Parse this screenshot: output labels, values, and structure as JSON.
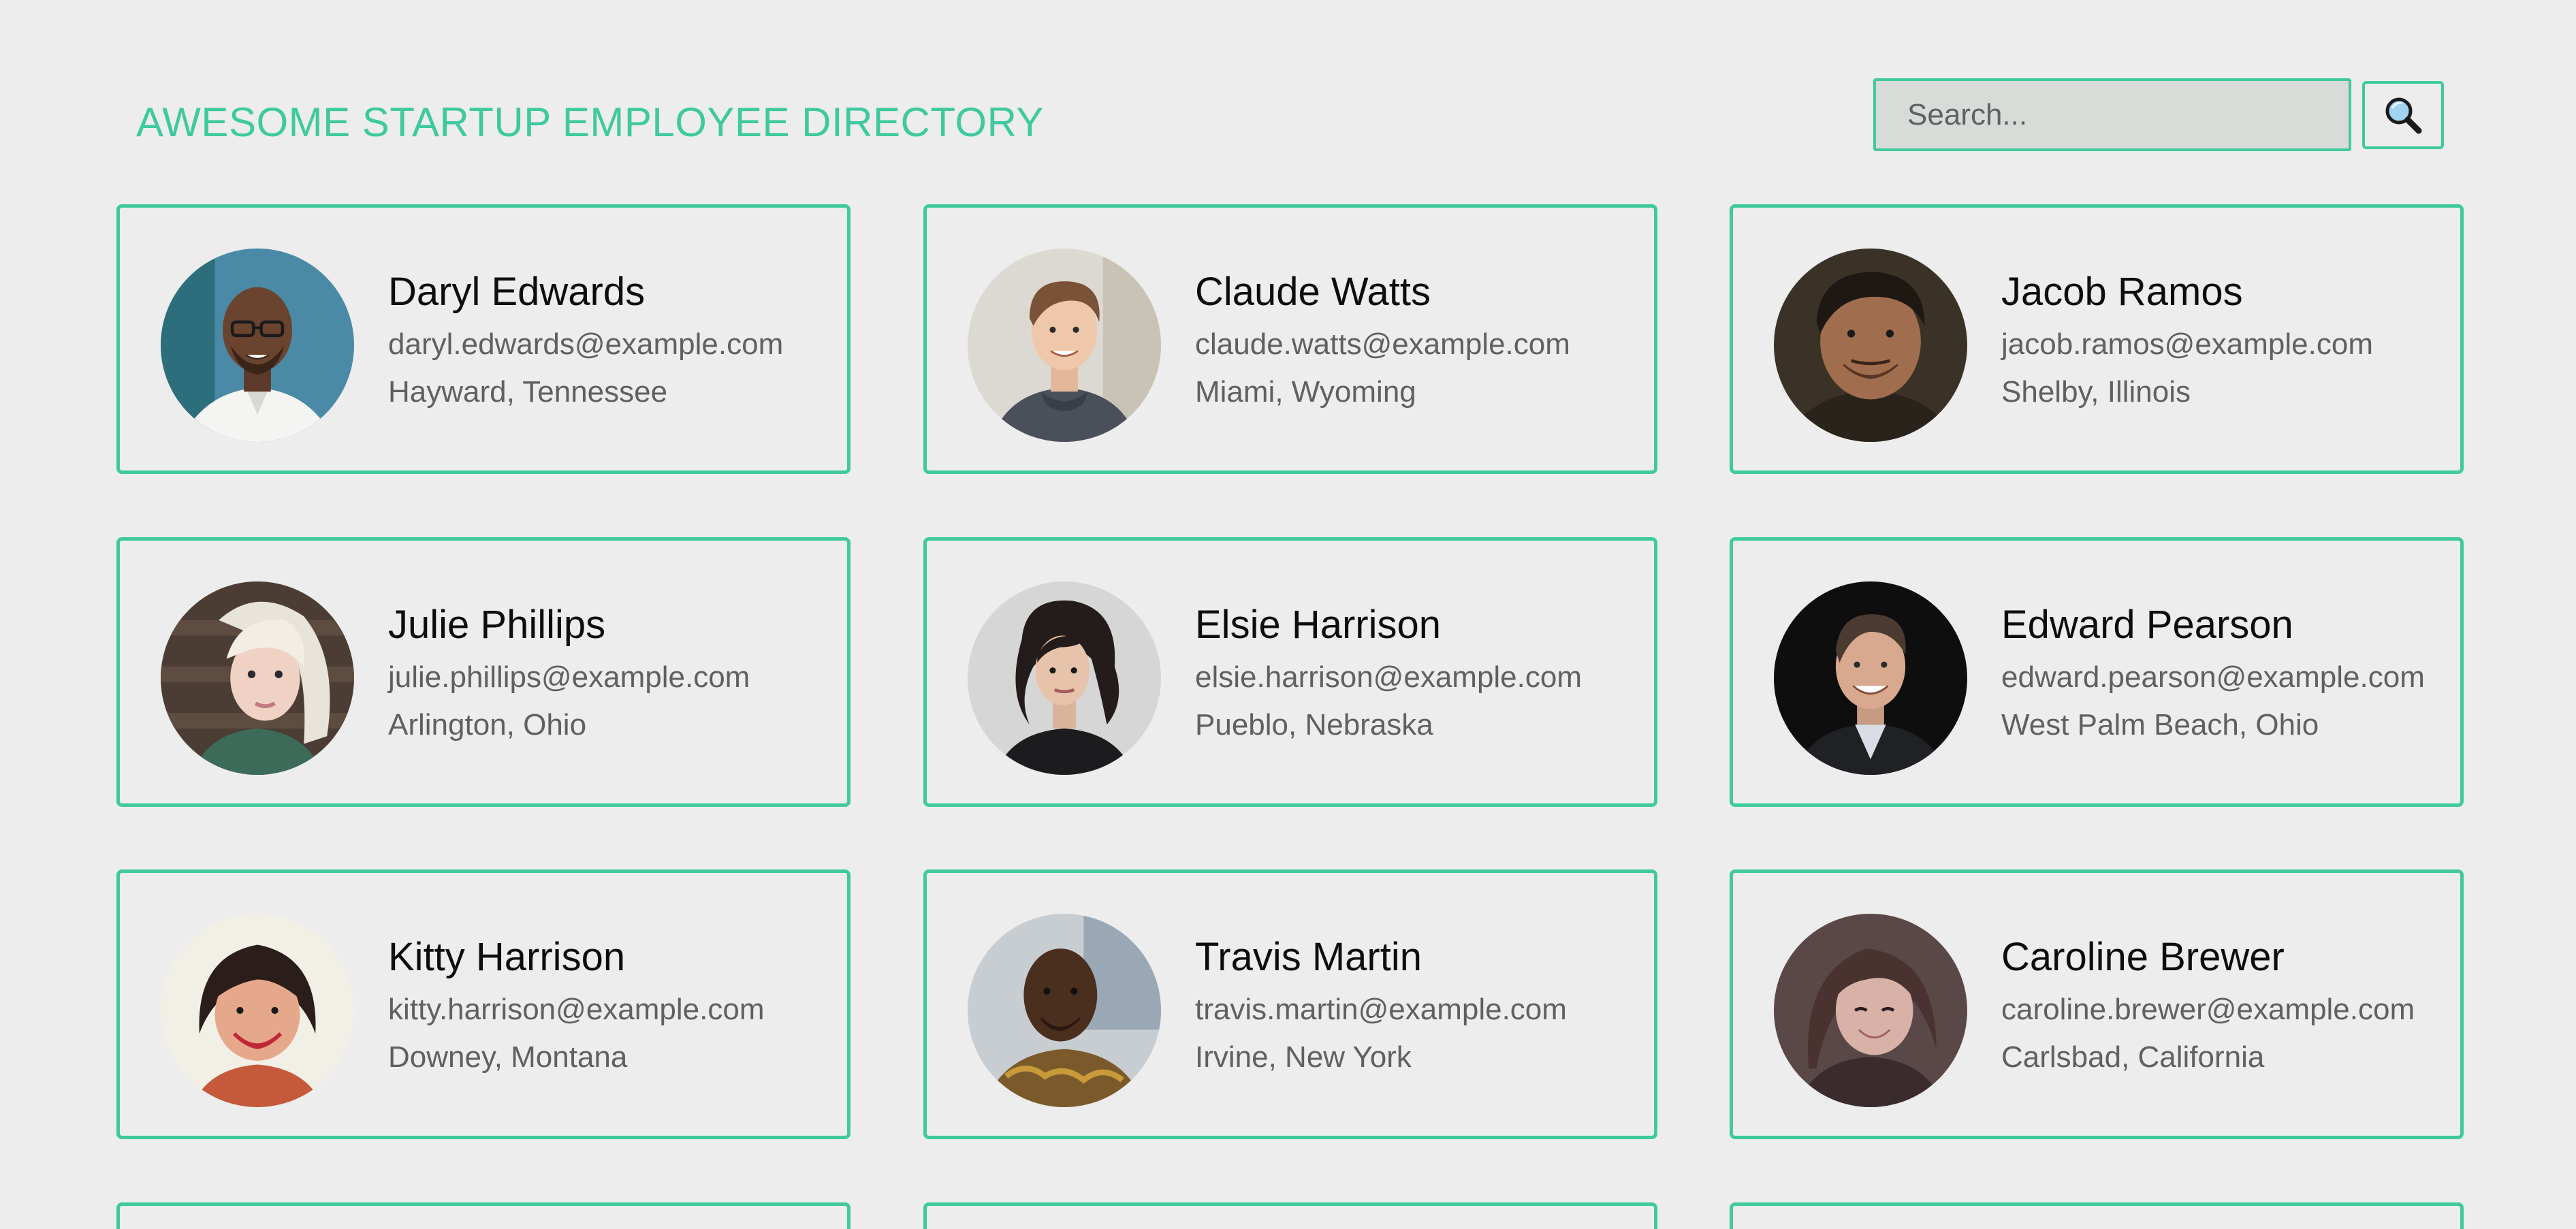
{
  "header": {
    "title": "AWESOME STARTUP EMPLOYEE DIRECTORY",
    "accent_color": "#3fc99f"
  },
  "search": {
    "placeholder": "Search...",
    "value": "",
    "button_icon": "magnifying-glass-icon"
  },
  "employees": [
    {
      "name": "Daryl Edwards",
      "email": "daryl.edwards@example.com",
      "location": "Hayward, Tennessee",
      "photo": "photo-man-glasses-white-shirt"
    },
    {
      "name": "Claude Watts",
      "email": "claude.watts@example.com",
      "location": "Miami, Wyoming",
      "photo": "photo-young-man-hoodie"
    },
    {
      "name": "Jacob Ramos",
      "email": "jacob.ramos@example.com",
      "location": "Shelby, Illinois",
      "photo": "photo-man-dark-hair-smiling"
    },
    {
      "name": "Julie Phillips",
      "email": "julie.phillips@example.com",
      "location": "Arlington, Ohio",
      "photo": "photo-woman-platinum-hair"
    },
    {
      "name": "Elsie Harrison",
      "email": "elsie.harrison@example.com",
      "location": "Pueblo, Nebraska",
      "photo": "photo-woman-dark-wavy-hair"
    },
    {
      "name": "Edward Pearson",
      "email": "edward.pearson@example.com",
      "location": "West Palm Beach, Ohio",
      "photo": "photo-man-dark-background"
    },
    {
      "name": "Kitty Harrison",
      "email": "kitty.harrison@example.com",
      "location": "Downey, Montana",
      "photo": "photo-woman-red-lipstick"
    },
    {
      "name": "Travis Martin",
      "email": "travis.martin@example.com",
      "location": "Irvine, New York",
      "photo": "photo-man-patterned-shirt"
    },
    {
      "name": "Caroline Brewer",
      "email": "caroline.brewer@example.com",
      "location": "Carlsbad, California",
      "photo": "photo-woman-brown-hair-smiling"
    }
  ]
}
